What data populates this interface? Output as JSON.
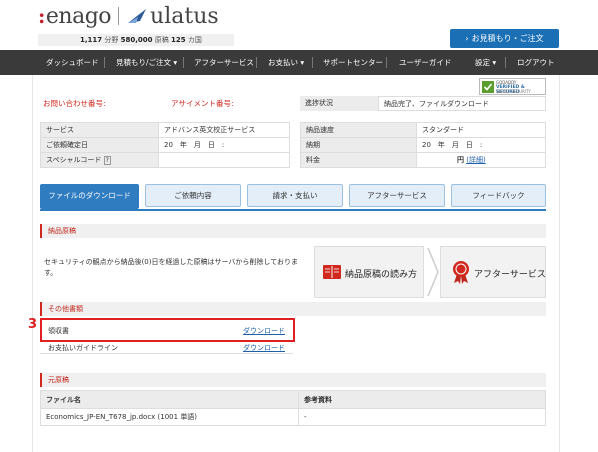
{
  "header": {
    "brand1": "enago",
    "brand2": "ulatus",
    "stats": {
      "num1": "1,117",
      "unit1": "分野",
      "num2": "580,000",
      "unit2": "原稿",
      "num3": "125",
      "unit3": "カ国"
    },
    "quote_button": "お見積もり・ご注文"
  },
  "nav": {
    "items": [
      "ダッシュボード",
      "見積もり/ご注文 ▾",
      "アフターサービス",
      "お支払い ▾",
      "サポートセンター",
      "ユーザーガイド",
      "設定 ▾",
      "ログアウト"
    ]
  },
  "badge": {
    "line1": "GODADDY",
    "line2": "VERIFIED & SECURED",
    "line3": "VERIFY SECURITY"
  },
  "order": {
    "inquiry_label": "お問い合わせ番号:",
    "assign_label": "アサイメント番号:",
    "progress_label": "進捗状況",
    "progress_value": "納品完了、ファイルダウンロード"
  },
  "info_left": [
    {
      "k": "サービス",
      "v": "アドバンス英文校正サービス"
    },
    {
      "k": "ご依頼確定日",
      "v": "20　年　月　日　:"
    },
    {
      "k": "スペシャルコード",
      "k_extra": "?",
      "v": ""
    }
  ],
  "info_right": [
    {
      "k": "納品速度",
      "v": "スタンダード"
    },
    {
      "k": "納期",
      "v": "20　年　月　日　:"
    },
    {
      "k": "料金",
      "v": "円",
      "link": "(詳細)"
    }
  ],
  "tabs": [
    "ファイルのダウンロード",
    "ご依頼内容",
    "請求・支払い",
    "アフターサービス",
    "フィードバック"
  ],
  "sections": {
    "delivered": "納品原稿",
    "other_docs": "その他書類",
    "original": "元原稿"
  },
  "security_text": "セキュリティの観点から納品後(0)日を経過した原稿はサーバから削除しております。",
  "buttons": {
    "how_to_read": "納品原稿の読み方",
    "after_service": "アフターサービス"
  },
  "other_docs": [
    {
      "name": "領収書",
      "action": "ダウンロード"
    },
    {
      "name": "お支払いガイドライン",
      "action": "ダウンロード"
    }
  ],
  "annotation_number": "3",
  "files": {
    "headers": [
      "ファイル名",
      "参考資料"
    ],
    "rows": [
      [
        "Economics_JP-EN_T678_jp.docx (1001 単語)",
        "-"
      ]
    ]
  },
  "colors": {
    "accent_blue": "#2f7cc1",
    "accent_red": "#d0281e",
    "nav_bg": "#3a3a3a",
    "highlight_red": "#e02020"
  }
}
